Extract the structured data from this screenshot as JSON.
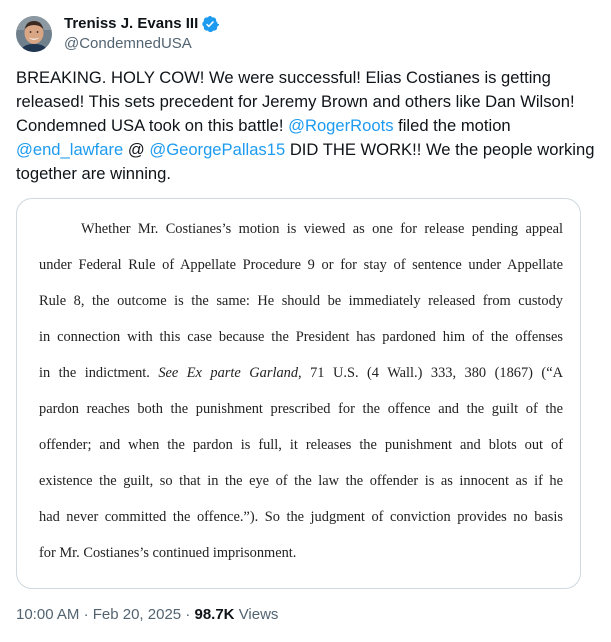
{
  "author": {
    "display_name": "Treniss J. Evans III",
    "handle": "@CondemnedUSA",
    "verified": true,
    "verified_color": "#1d9bf0"
  },
  "tweet": {
    "text_parts": [
      {
        "type": "text",
        "value": "BREAKING. HOLY COW!  We were successful!  Elias Costianes is getting released!  This sets precedent for Jeremy Brown and others like Dan Wilson!  Condemned USA took on this battle!  "
      },
      {
        "type": "mention",
        "value": "@RogerRoots"
      },
      {
        "type": "text",
        "value": " filed the motion "
      },
      {
        "type": "mention",
        "value": "@end_lawfare"
      },
      {
        "type": "text",
        "value": " @ "
      },
      {
        "type": "mention",
        "value": "@GeorgePallas15"
      },
      {
        "type": "text",
        "value": " DID THE WORK!!  We the people working together are winning."
      }
    ],
    "mention_color": "#1d9bf0"
  },
  "document": {
    "lines": [
      "Whether Mr. Costianes’s motion is viewed as one for release pending appeal",
      "under Federal Rule of Appellate Procedure 9 or for stay of sentence under Appellate",
      "Rule 8, the outcome is the same: He should be immediately released from custody",
      "in connection with this case because the President has pardoned him of the offenses",
      "in the indictment. See Ex parte Garland, 71 U.S. (4 Wall.) 333, 380 (1867) (“A",
      "pardon reaches both the punishment prescribed for the offence and the guilt of the",
      "offender; and when the pardon is full, it releases the punishment and blots out of",
      "existence the guilt, so that in the eye of the law the offender is as innocent as if he",
      "had never committed the offence.”). So the judgment of conviction provides no basis",
      "for Mr. Costianes’s continued imprisonment."
    ],
    "italic_phrase": "See Ex parte Garland"
  },
  "footer": {
    "time": "10:00 AM",
    "separator": "·",
    "date": "Feb 20, 2025",
    "views_count": "98.7K",
    "views_label": "Views"
  }
}
